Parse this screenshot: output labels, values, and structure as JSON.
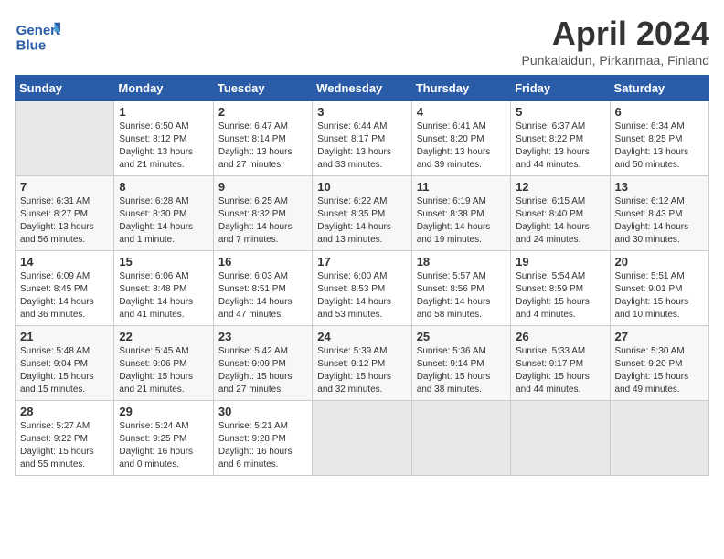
{
  "header": {
    "logo_general": "General",
    "logo_blue": "Blue",
    "month_title": "April 2024",
    "location": "Punkalaidun, Pirkanmaa, Finland"
  },
  "weekdays": [
    "Sunday",
    "Monday",
    "Tuesday",
    "Wednesday",
    "Thursday",
    "Friday",
    "Saturday"
  ],
  "weeks": [
    [
      {
        "day": "",
        "empty": true
      },
      {
        "day": "1",
        "sunrise": "6:50 AM",
        "sunset": "8:12 PM",
        "daylight": "13 hours and 21 minutes."
      },
      {
        "day": "2",
        "sunrise": "6:47 AM",
        "sunset": "8:14 PM",
        "daylight": "13 hours and 27 minutes."
      },
      {
        "day": "3",
        "sunrise": "6:44 AM",
        "sunset": "8:17 PM",
        "daylight": "13 hours and 33 minutes."
      },
      {
        "day": "4",
        "sunrise": "6:41 AM",
        "sunset": "8:20 PM",
        "daylight": "13 hours and 39 minutes."
      },
      {
        "day": "5",
        "sunrise": "6:37 AM",
        "sunset": "8:22 PM",
        "daylight": "13 hours and 44 minutes."
      },
      {
        "day": "6",
        "sunrise": "6:34 AM",
        "sunset": "8:25 PM",
        "daylight": "13 hours and 50 minutes."
      }
    ],
    [
      {
        "day": "7",
        "sunrise": "6:31 AM",
        "sunset": "8:27 PM",
        "daylight": "13 hours and 56 minutes."
      },
      {
        "day": "8",
        "sunrise": "6:28 AM",
        "sunset": "8:30 PM",
        "daylight": "14 hours and 1 minute."
      },
      {
        "day": "9",
        "sunrise": "6:25 AM",
        "sunset": "8:32 PM",
        "daylight": "14 hours and 7 minutes."
      },
      {
        "day": "10",
        "sunrise": "6:22 AM",
        "sunset": "8:35 PM",
        "daylight": "14 hours and 13 minutes."
      },
      {
        "day": "11",
        "sunrise": "6:19 AM",
        "sunset": "8:38 PM",
        "daylight": "14 hours and 19 minutes."
      },
      {
        "day": "12",
        "sunrise": "6:15 AM",
        "sunset": "8:40 PM",
        "daylight": "14 hours and 24 minutes."
      },
      {
        "day": "13",
        "sunrise": "6:12 AM",
        "sunset": "8:43 PM",
        "daylight": "14 hours and 30 minutes."
      }
    ],
    [
      {
        "day": "14",
        "sunrise": "6:09 AM",
        "sunset": "8:45 PM",
        "daylight": "14 hours and 36 minutes."
      },
      {
        "day": "15",
        "sunrise": "6:06 AM",
        "sunset": "8:48 PM",
        "daylight": "14 hours and 41 minutes."
      },
      {
        "day": "16",
        "sunrise": "6:03 AM",
        "sunset": "8:51 PM",
        "daylight": "14 hours and 47 minutes."
      },
      {
        "day": "17",
        "sunrise": "6:00 AM",
        "sunset": "8:53 PM",
        "daylight": "14 hours and 53 minutes."
      },
      {
        "day": "18",
        "sunrise": "5:57 AM",
        "sunset": "8:56 PM",
        "daylight": "14 hours and 58 minutes."
      },
      {
        "day": "19",
        "sunrise": "5:54 AM",
        "sunset": "8:59 PM",
        "daylight": "15 hours and 4 minutes."
      },
      {
        "day": "20",
        "sunrise": "5:51 AM",
        "sunset": "9:01 PM",
        "daylight": "15 hours and 10 minutes."
      }
    ],
    [
      {
        "day": "21",
        "sunrise": "5:48 AM",
        "sunset": "9:04 PM",
        "daylight": "15 hours and 15 minutes."
      },
      {
        "day": "22",
        "sunrise": "5:45 AM",
        "sunset": "9:06 PM",
        "daylight": "15 hours and 21 minutes."
      },
      {
        "day": "23",
        "sunrise": "5:42 AM",
        "sunset": "9:09 PM",
        "daylight": "15 hours and 27 minutes."
      },
      {
        "day": "24",
        "sunrise": "5:39 AM",
        "sunset": "9:12 PM",
        "daylight": "15 hours and 32 minutes."
      },
      {
        "day": "25",
        "sunrise": "5:36 AM",
        "sunset": "9:14 PM",
        "daylight": "15 hours and 38 minutes."
      },
      {
        "day": "26",
        "sunrise": "5:33 AM",
        "sunset": "9:17 PM",
        "daylight": "15 hours and 44 minutes."
      },
      {
        "day": "27",
        "sunrise": "5:30 AM",
        "sunset": "9:20 PM",
        "daylight": "15 hours and 49 minutes."
      }
    ],
    [
      {
        "day": "28",
        "sunrise": "5:27 AM",
        "sunset": "9:22 PM",
        "daylight": "15 hours and 55 minutes."
      },
      {
        "day": "29",
        "sunrise": "5:24 AM",
        "sunset": "9:25 PM",
        "daylight": "16 hours and 0 minutes."
      },
      {
        "day": "30",
        "sunrise": "5:21 AM",
        "sunset": "9:28 PM",
        "daylight": "16 hours and 6 minutes."
      },
      {
        "day": "",
        "empty": true
      },
      {
        "day": "",
        "empty": true
      },
      {
        "day": "",
        "empty": true
      },
      {
        "day": "",
        "empty": true
      }
    ]
  ]
}
